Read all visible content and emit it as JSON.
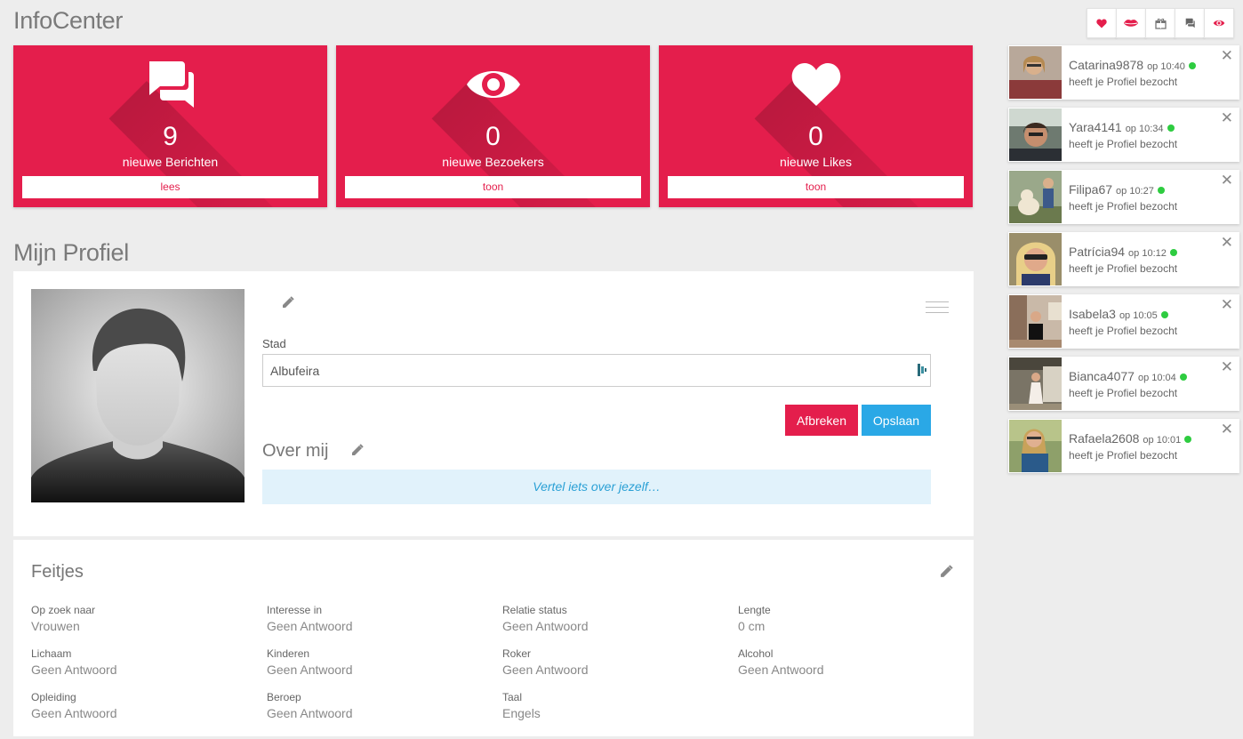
{
  "infocenter": {
    "title": "InfoCenter",
    "cards": [
      {
        "count": "9",
        "caption": "nieuwe Berichten",
        "button": "lees",
        "icon": "chat-icon"
      },
      {
        "count": "0",
        "caption": "nieuwe Bezoekers",
        "button": "toon",
        "icon": "eye-icon"
      },
      {
        "count": "0",
        "caption": "nieuwe Likes",
        "button": "toon",
        "icon": "heart-icon"
      }
    ]
  },
  "iconbar": [
    "heart-icon",
    "lips-icon",
    "gift-icon",
    "chat-icon",
    "eye-icon"
  ],
  "visitors": [
    {
      "name": "Catarina9878",
      "time": "op 10:40",
      "action": "heeft je Profiel bezocht"
    },
    {
      "name": "Yara4141",
      "time": "op 10:34",
      "action": "heeft je Profiel bezocht"
    },
    {
      "name": "Filipa67",
      "time": "op 10:27",
      "action": "heeft je Profiel bezocht"
    },
    {
      "name": "Patrícia94",
      "time": "op 10:12",
      "action": "heeft je Profiel bezocht"
    },
    {
      "name": "Isabela3",
      "time": "op 10:05",
      "action": "heeft je Profiel bezocht"
    },
    {
      "name": "Bianca4077",
      "time": "op 10:04",
      "action": "heeft je Profiel bezocht"
    },
    {
      "name": "Rafaela2608",
      "time": "op 10:01",
      "action": "heeft je Profiel bezocht"
    }
  ],
  "profile": {
    "title": "Mijn Profiel",
    "city_label": "Stad",
    "city_value": "Albufeira",
    "cancel": "Afbreken",
    "save": "Opslaan",
    "about_title": "Over mij",
    "about_placeholder": "Vertel iets over jezelf…"
  },
  "facts": {
    "title": "Feitjes",
    "items": [
      {
        "label": "Op zoek naar",
        "value": "Vrouwen"
      },
      {
        "label": "Interesse in",
        "value": "Geen Antwoord"
      },
      {
        "label": "Relatie status",
        "value": "Geen Antwoord"
      },
      {
        "label": "Lengte",
        "value": "0 cm"
      },
      {
        "label": "Lichaam",
        "value": "Geen Antwoord"
      },
      {
        "label": "Kinderen",
        "value": "Geen Antwoord"
      },
      {
        "label": "Roker",
        "value": "Geen Antwoord"
      },
      {
        "label": "Alcohol",
        "value": "Geen Antwoord"
      },
      {
        "label": "Opleiding",
        "value": "Geen Antwoord"
      },
      {
        "label": "Beroep",
        "value": "Geen Antwoord"
      },
      {
        "label": "Taal",
        "value": "Engels"
      }
    ]
  },
  "colors": {
    "accent": "#e41e4c",
    "save": "#2aa8e6",
    "online": "#2ecc40"
  }
}
